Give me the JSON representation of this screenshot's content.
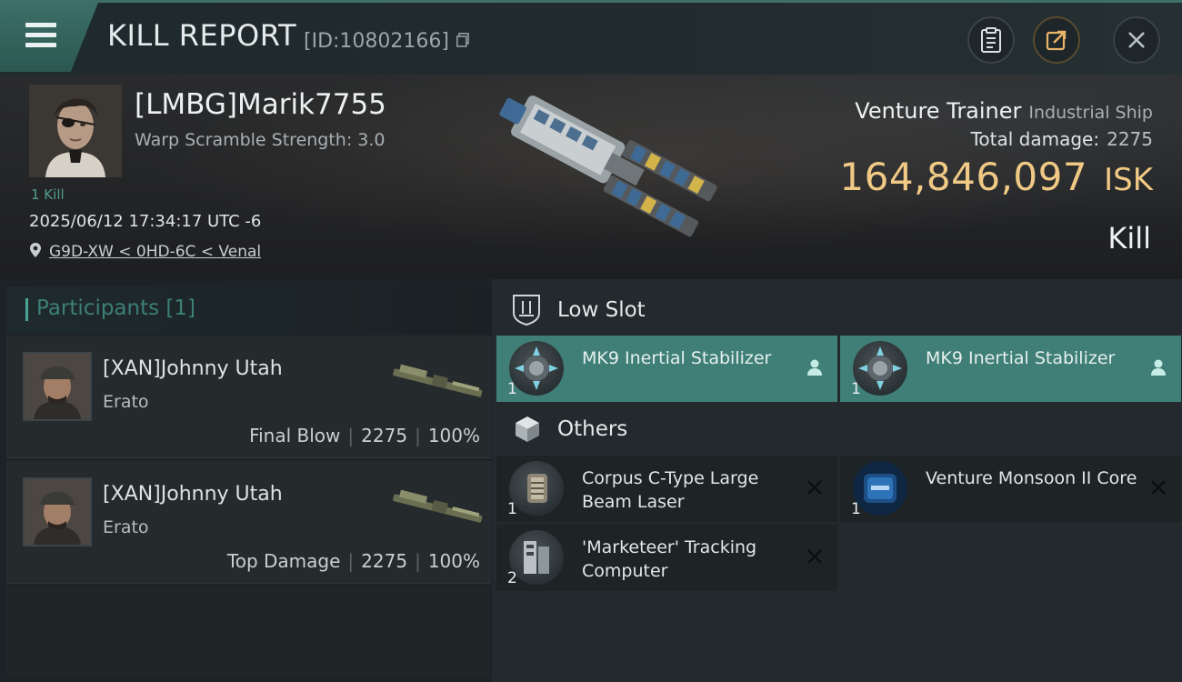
{
  "header": {
    "title": "KILL REPORT",
    "report_id": "[ID:10802166]",
    "buttons": [
      "clipboard-icon",
      "share-icon",
      "close-icon"
    ]
  },
  "victim": {
    "name": "[LMBG]Marik7755",
    "warp_scramble": "Warp Scramble Strength: 3.0",
    "kills": "1 Kill",
    "datetime": "2025/06/12 17:34:17 UTC -6",
    "location": "G9D-XW < 0HD-6C < Venal",
    "ship_name": "Venture Trainer",
    "ship_class": "Industrial Ship",
    "total_damage_label": "Total damage:",
    "total_damage": "2275",
    "isk_value": "164,846,097",
    "isk_unit": "ISK",
    "result": "Kill"
  },
  "participants": {
    "title": "Participants [1]",
    "list": [
      {
        "name": "[XAN]Johnny Utah",
        "ship": "Erato",
        "role": "Final Blow",
        "damage": "2275",
        "percent": "100%"
      },
      {
        "name": "[XAN]Johnny Utah",
        "ship": "Erato",
        "role": "Top Damage",
        "damage": "2275",
        "percent": "100%"
      }
    ]
  },
  "sections": {
    "low_slot": {
      "title": "Low Slot",
      "items": [
        {
          "qty": "1",
          "name": "MK9 Inertial Stabilizer",
          "state": "fitted"
        },
        {
          "qty": "1",
          "name": "MK9 Inertial Stabilizer",
          "state": "fitted"
        }
      ]
    },
    "others": {
      "title": "Others",
      "items": [
        {
          "qty": "1",
          "name": "Corpus C-Type Large Beam Laser",
          "state": "destroyed"
        },
        {
          "qty": "1",
          "name": "Venture Monsoon II Core",
          "state": "destroyed"
        },
        {
          "qty": "2",
          "name": "'Marketeer' Tracking Computer",
          "state": "destroyed"
        }
      ]
    }
  },
  "colors": {
    "accent": "#3f7f77",
    "isk": "#f0c985",
    "participants_title": "#3c7f76"
  }
}
